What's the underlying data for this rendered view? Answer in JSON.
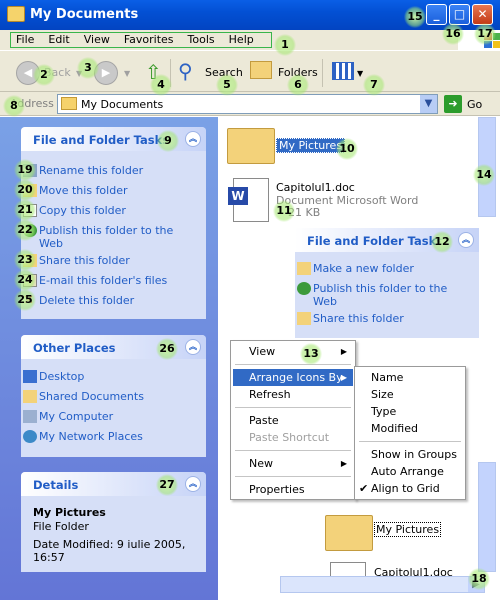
{
  "window": {
    "title": "My Documents"
  },
  "menu": [
    "File",
    "Edit",
    "View",
    "Favorites",
    "Tools",
    "Help"
  ],
  "toolbar": {
    "back": "Back",
    "search": "Search",
    "folders": "Folders"
  },
  "address": {
    "label": "Address",
    "value": "My Documents",
    "go": "Go"
  },
  "file_tasks": {
    "title": "File and Folder Tasks",
    "items": [
      "Rename this folder",
      "Move this folder",
      "Copy this folder",
      "Publish this folder to the Web",
      "Share this folder",
      "E-mail this folder's files",
      "Delete this folder"
    ]
  },
  "other_places": {
    "title": "Other Places",
    "items": [
      "Desktop",
      "Shared Documents",
      "My Computer",
      "My Network Places"
    ]
  },
  "details": {
    "title": "Details",
    "name": "My Pictures",
    "type": "File Folder",
    "modified": "Date Modified: 9 iulie 2005, 16:57"
  },
  "files": [
    {
      "name": "My Pictures"
    },
    {
      "name": "Capitolul1.doc",
      "type": "Document Microsoft Word",
      "size": "21 KB"
    }
  ],
  "file_tasks_float": {
    "title": "File and Folder Tasks",
    "items": [
      "Make a new folder",
      "Publish this folder to the Web",
      "Share this folder"
    ]
  },
  "context_menu": {
    "items": [
      "View",
      "Arrange Icons By",
      "Refresh",
      "Paste",
      "Paste Shortcut",
      "New",
      "Properties"
    ]
  },
  "arrange_submenu": {
    "items": [
      "Name",
      "Size",
      "Type",
      "Modified",
      "Show in Groups",
      "Auto Arrange",
      "Align to Grid"
    ],
    "checked": "Align to Grid"
  },
  "files_bottom": [
    "My Pictures",
    "Capitolul1.doc"
  ],
  "callouts": [
    "1",
    "2",
    "3",
    "4",
    "5",
    "6",
    "7",
    "8",
    "9",
    "10",
    "11",
    "12",
    "13",
    "14",
    "15",
    "16",
    "17",
    "18",
    "19",
    "20",
    "21",
    "22",
    "23",
    "24",
    "25",
    "26",
    "27"
  ]
}
